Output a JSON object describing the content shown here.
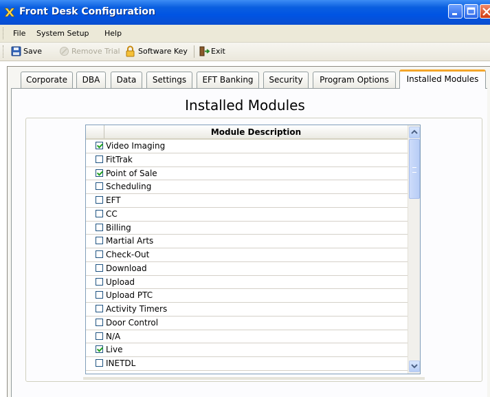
{
  "window": {
    "title": "Front Desk Configuration"
  },
  "menu": {
    "items": [
      "File",
      "System Setup",
      "Help"
    ]
  },
  "toolbar": {
    "save": "Save",
    "remove_trial": "Remove Trial",
    "software_key": "Software Key",
    "exit": "Exit"
  },
  "tabs": [
    "Corporate",
    "DBA",
    "Data",
    "Settings",
    "EFT Banking",
    "Security",
    "Program Options",
    "Installed Modules"
  ],
  "active_tab": "Installed Modules",
  "section": {
    "heading": "Installed Modules"
  },
  "grid": {
    "column_header": "Module Description",
    "rows": [
      {
        "label": "Video Imaging",
        "checked": true
      },
      {
        "label": "FitTrak",
        "checked": false
      },
      {
        "label": "Point of Sale",
        "checked": true
      },
      {
        "label": "Scheduling",
        "checked": false
      },
      {
        "label": "EFT",
        "checked": false
      },
      {
        "label": "CC",
        "checked": false
      },
      {
        "label": "Billing",
        "checked": false
      },
      {
        "label": "Martial Arts",
        "checked": false
      },
      {
        "label": "Check-Out",
        "checked": false
      },
      {
        "label": "Download",
        "checked": false
      },
      {
        "label": "Upload",
        "checked": false
      },
      {
        "label": "Upload PTC",
        "checked": false
      },
      {
        "label": "Activity Timers",
        "checked": false
      },
      {
        "label": "Door Control",
        "checked": false
      },
      {
        "label": "N/A",
        "checked": false
      },
      {
        "label": "Live",
        "checked": true
      },
      {
        "label": "INETDL",
        "checked": false
      }
    ]
  },
  "colors": {
    "titlebar": "#0054e3",
    "active_tab_accent": "#f4a52a",
    "check_mark": "#21a121"
  }
}
